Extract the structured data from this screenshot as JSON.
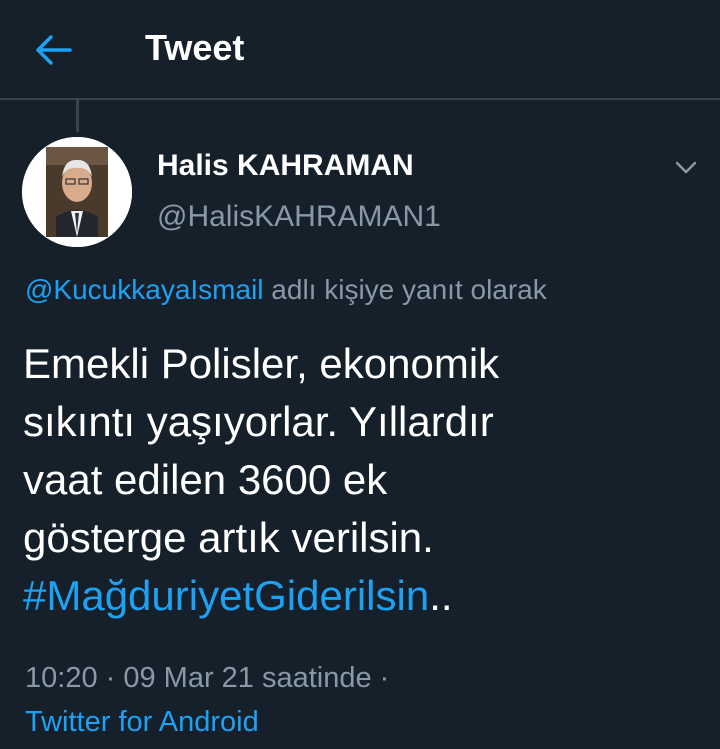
{
  "header": {
    "title": "Tweet",
    "back_icon": "arrow-left-icon"
  },
  "author": {
    "name": "Halis KAHRAMAN",
    "handle": "@HalisKAHRAMAN1"
  },
  "reply": {
    "mention": "@KucukkayaIsmail",
    "suffix": "adlı kişiye yanıt olarak"
  },
  "tweet": {
    "lines": [
      "Emekli Polisler, ekonomik",
      "sıkıntı yaşıyorlar. Yıllardır",
      "vaat edilen 3600 ek",
      "gösterge artık verilsin."
    ],
    "hashtag": "#MağduriyetGiderilsin",
    "hashtag_suffix": ".."
  },
  "meta": {
    "time_line": "10:20 · 09 Mar 21 saatinde ·",
    "source": "Twitter for Android"
  },
  "colors": {
    "background": "#15202b",
    "accent": "#1da1f2",
    "secondary_text": "#8899a6",
    "divider": "#38444d"
  }
}
